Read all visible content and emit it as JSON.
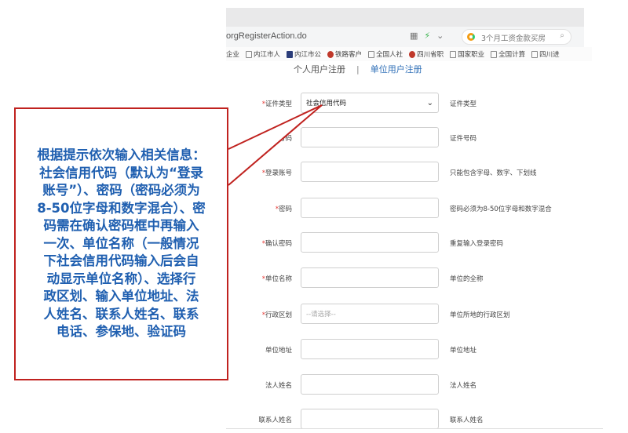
{
  "browser": {
    "url": "orgRegisterAction.do",
    "search_text": "3个月工资金款买房",
    "bookmarks": [
      "企业",
      "内江市人",
      "内江市公",
      "铁路客户",
      "全国人社",
      "四川省职",
      "国家职业",
      "全国计算",
      "四川进"
    ]
  },
  "tabs": {
    "personal": "个人用户注册",
    "separator": "|",
    "unit": "单位用户注册"
  },
  "form": {
    "required_mark": "*",
    "rows": [
      {
        "label": "证件类型",
        "required": true,
        "type": "select",
        "value": "社会信用代码",
        "hint": "证件类型"
      },
      {
        "label": "证件号码",
        "required": true,
        "type": "input",
        "value": "",
        "hint": "证件号码"
      },
      {
        "label": "登录账号",
        "required": true,
        "type": "input",
        "value": "",
        "hint": "只能包含字母、数字、下划线"
      },
      {
        "label": "密码",
        "required": true,
        "type": "input",
        "value": "",
        "hint": "密码必须为8-50位字母和数字混合"
      },
      {
        "label": "确认密码",
        "required": true,
        "type": "input",
        "value": "",
        "hint": "重复输入登录密码"
      },
      {
        "label": "单位名称",
        "required": true,
        "type": "input",
        "value": "",
        "hint": "单位的全称"
      },
      {
        "label": "行政区划",
        "required": true,
        "type": "select",
        "value": "--请选择--",
        "hint": "单位所地的行政区划"
      },
      {
        "label": "单位地址",
        "required": false,
        "type": "input",
        "value": "",
        "hint": "单位地址"
      },
      {
        "label": "法人姓名",
        "required": false,
        "type": "input",
        "value": "",
        "hint": "法人姓名"
      },
      {
        "label": "联系人姓名",
        "required": false,
        "type": "input",
        "value": "",
        "hint": "联系人姓名"
      }
    ]
  },
  "annotation": {
    "text": "根据提示依次输入相关信息：社会信用代码（默认为“登录账号”）、密码（密码必须为8-50位字母和数字混合）、密码需在确认密码框中再输入一次、单位名称（一般情况下社会信用代码输入后会自动显示单位名称）、选择行政区划、输入单位地址、法人姓名、联系人姓名、联系电话、参保地、验证码",
    "lines": [
      "根据提示依次输入相关信息：",
      "社会信用代码（默认为“登录",
      "账号”）、密码（密码必须为",
      "8-50位字母和数字混合）、密",
      "码需在确认密码框中再输入",
      "一次、单位名称（一般情况",
      "下社会信用代码输入后会自",
      "动显示单位名称）、选择行",
      "政区划、输入单位地址、法",
      "人姓名、联系人姓名、联系",
      "电话、参保地、验证码"
    ],
    "border_color": "#c0221f",
    "text_color": "#1f5fb0"
  }
}
